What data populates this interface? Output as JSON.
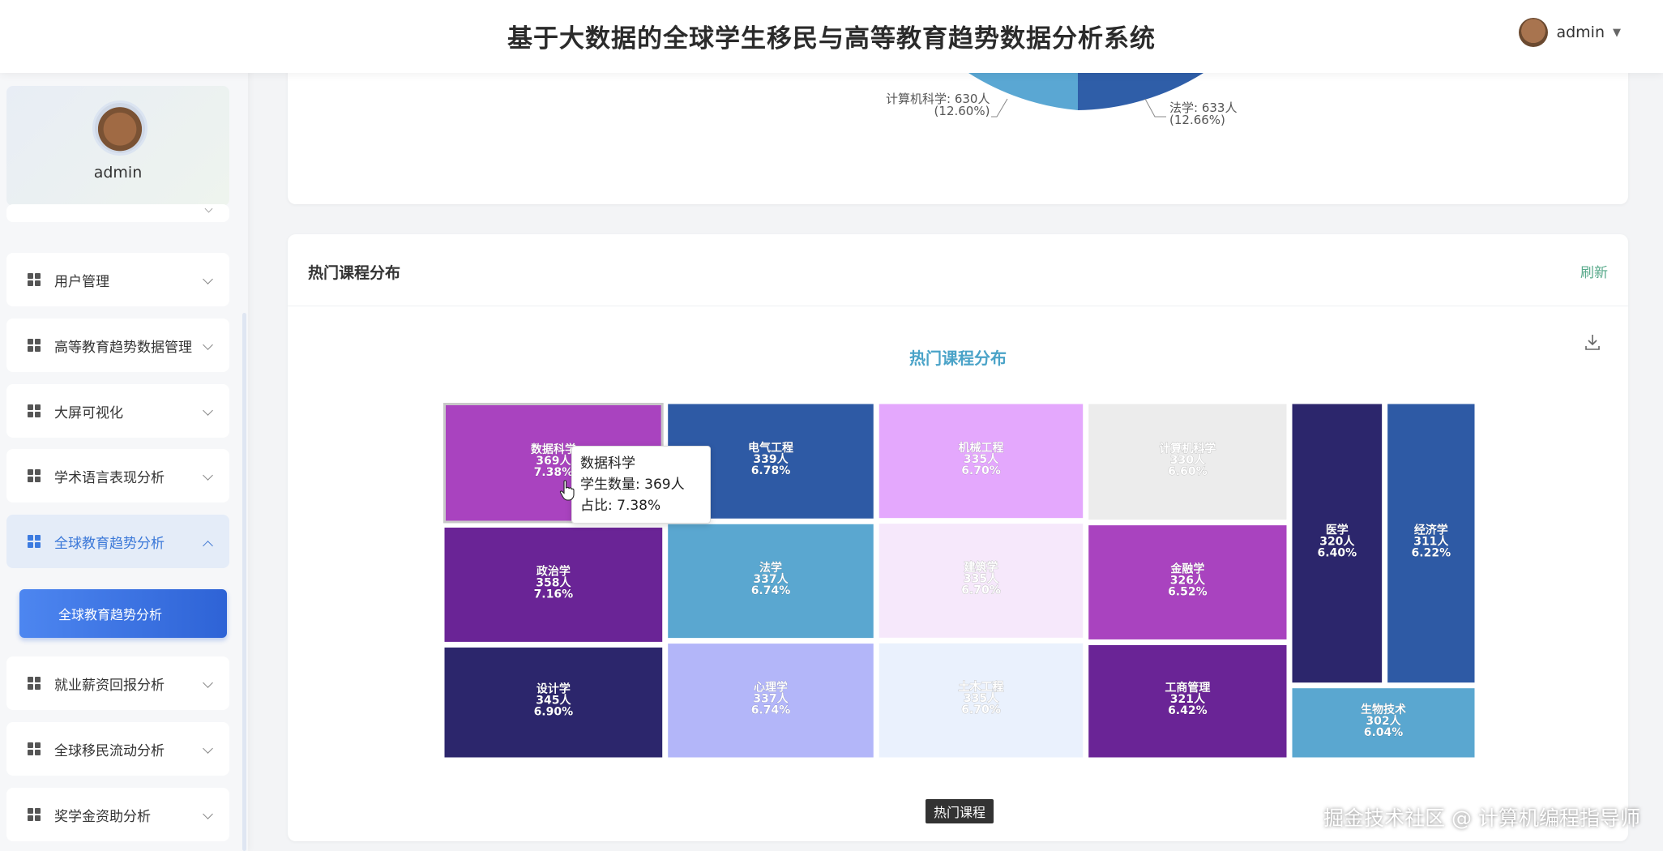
{
  "header": {
    "title": "基于大数据的全球学生移民与高等教育趋势数据分析系统",
    "user": "admin"
  },
  "sidebar": {
    "profile_name": "admin",
    "items": [
      {
        "label": "用户管理"
      },
      {
        "label": "高等教育趋势数据管理"
      },
      {
        "label": "大屏可视化"
      },
      {
        "label": "学术语言表现分析"
      },
      {
        "label": "全球教育趋势分析"
      },
      {
        "label": "就业薪资回报分析"
      },
      {
        "label": "全球移民流动分析"
      },
      {
        "label": "奖学金资助分析"
      }
    ],
    "active_sub": "全球教育趋势分析"
  },
  "top_card": {
    "pie_labels": [
      {
        "line1": "计算机科学: 630人",
        "line2": "(12.60%)"
      },
      {
        "line1": "法学: 633人",
        "line2": "(12.66%)"
      }
    ],
    "pie_colors": [
      "#5aa7d3",
      "#2f5ea8"
    ]
  },
  "main_card": {
    "title": "热门课程分布",
    "refresh_label": "刷新",
    "chart_title": "热门课程分布",
    "bottom_tag": "热门课程"
  },
  "tooltip": {
    "name": "数据科学",
    "count": "学生数量: 369人",
    "pct": "占比: 7.38%"
  },
  "watermark": "掘金技术社区 @ 计算机编程指导师",
  "chart_data": {
    "type": "treemap",
    "title": "热门课程分布",
    "unit": "人",
    "items": [
      {
        "name": "数据科学",
        "value": 369,
        "pct": "7.38%",
        "color": "#a943bf"
      },
      {
        "name": "政治学",
        "value": 358,
        "pct": "7.16%",
        "color": "#6a2496"
      },
      {
        "name": "设计学",
        "value": 345,
        "pct": "6.90%",
        "color": "#2c266c"
      },
      {
        "name": "电气工程",
        "value": 339,
        "pct": "6.78%",
        "color": "#2e5aa5"
      },
      {
        "name": "法学",
        "value": 337,
        "pct": "6.74%",
        "color": "#5aa7d0"
      },
      {
        "name": "心理学",
        "value": 337,
        "pct": "6.74%",
        "color": "#b3b6f9"
      },
      {
        "name": "机械工程",
        "value": 335,
        "pct": "6.70%",
        "color": "#e4a8fd"
      },
      {
        "name": "建筑学",
        "value": 335,
        "pct": "6.70%",
        "color": "#f6e8fb"
      },
      {
        "name": "土木工程",
        "value": 335,
        "pct": "6.70%",
        "color": "#eaf1fd"
      },
      {
        "name": "计算机科学",
        "value": 330,
        "pct": "6.60%",
        "color": "#ececec"
      },
      {
        "name": "金融学",
        "value": 326,
        "pct": "6.52%",
        "color": "#a943bf"
      },
      {
        "name": "工商管理",
        "value": 321,
        "pct": "6.42%",
        "color": "#6a2496"
      },
      {
        "name": "医学",
        "value": 320,
        "pct": "6.40%",
        "color": "#2c266c"
      },
      {
        "name": "经济学",
        "value": 311,
        "pct": "6.22%",
        "color": "#2e5aa5"
      },
      {
        "name": "生物技术",
        "value": 302,
        "pct": "6.04%",
        "color": "#5aa7d0"
      }
    ]
  }
}
